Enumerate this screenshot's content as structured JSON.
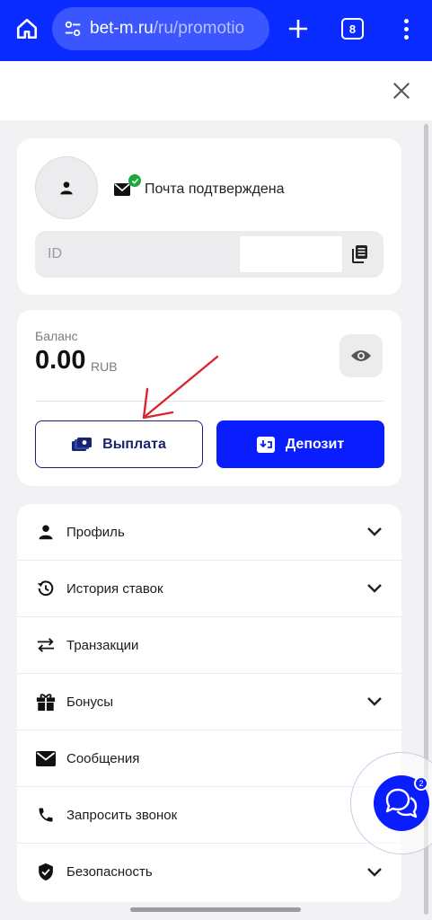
{
  "browser": {
    "url_host": "bet-m.ru",
    "url_path": "/ru/promotio",
    "tab_count": "8"
  },
  "profile": {
    "email_status": "Почта подтверждена",
    "id_label": "ID"
  },
  "balance": {
    "label": "Баланс",
    "amount": "0.00",
    "currency": "RUB",
    "withdraw_label": "Выплата",
    "deposit_label": "Депозит"
  },
  "menu": {
    "items": [
      {
        "label": "Профиль",
        "icon": "person-icon",
        "expandable": true
      },
      {
        "label": "История ставок",
        "icon": "history-icon",
        "expandable": true
      },
      {
        "label": "Транзакции",
        "icon": "transfer-icon",
        "expandable": false
      },
      {
        "label": "Бонусы",
        "icon": "gift-icon",
        "expandable": true
      },
      {
        "label": "Сообщения",
        "icon": "mail-icon",
        "expandable": false
      },
      {
        "label": "Запросить звонок",
        "icon": "phone-icon",
        "expandable": false
      },
      {
        "label": "Безопасность",
        "icon": "shield-icon",
        "expandable": true
      }
    ]
  },
  "chat": {
    "badge": "2"
  },
  "colors": {
    "brand_blue": "#0a1dff",
    "browser_bar": "#0a2bff",
    "verified_green": "#1fa83a",
    "annotation_red": "#d8262b"
  }
}
